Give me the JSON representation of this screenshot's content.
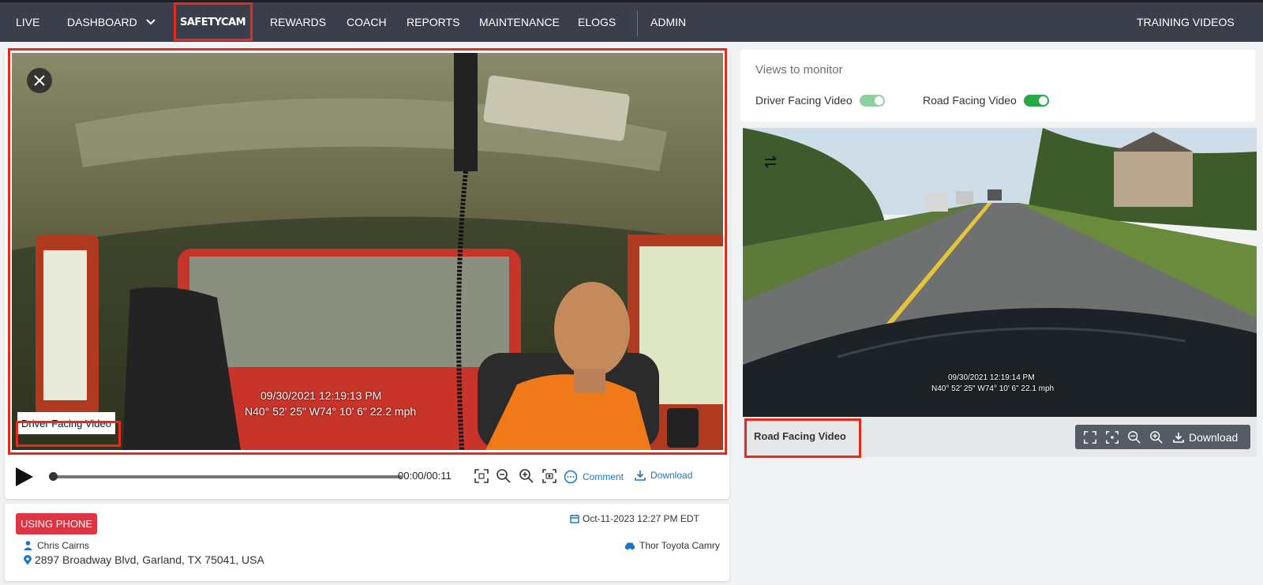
{
  "nav": {
    "live": "LIVE",
    "dashboard": "DASHBOARD",
    "safetycam": "SAFETYCAM",
    "rewards": "REWARDS",
    "coach": "COACH",
    "reports": "REPORTS",
    "maintenance": "MAINTENANCE",
    "elogs": "ELOGS",
    "admin": "ADMIN",
    "training_videos": "TRAINING VIDEOS"
  },
  "driver_video": {
    "label": "Driver Facing Video",
    "osd_datetime": "09/30/2021 12:19:13 PM",
    "osd_location": "N40° 52' 25\" W74° 10' 6\" 22.2 mph",
    "close_icon": "close-icon"
  },
  "player": {
    "time": "00:00/00:11",
    "progress": 0,
    "comment_label": "Comment",
    "download_label": "Download",
    "icons": [
      "play-icon",
      "fullscreen-icon",
      "zoom-out-icon",
      "zoom-in-icon",
      "screenshot-icon",
      "comment-icon",
      "download-icon"
    ]
  },
  "event": {
    "badge": "USING PHONE",
    "badge_color": "#dc3545",
    "datetime": "Oct-11-2023 12:27 PM EDT",
    "driver": "Chris Cairns",
    "address": "2897 Broadway Blvd, Garland, TX 75041, USA",
    "vehicle": "Thor Toyota Camry"
  },
  "views": {
    "title": "Views to monitor",
    "driver_toggle_label": "Driver Facing Video",
    "driver_toggle_on": true,
    "driver_toggle_color": "#8fd19e",
    "road_toggle_label": "Road Facing Video",
    "road_toggle_on": true,
    "road_toggle_color": "#28a745"
  },
  "road_video": {
    "label": "Road Facing Video",
    "osd_datetime": "09/30/2021 12:19:14 PM",
    "osd_location": "N40° 52' 25\" W74° 10' 6\" 22.1 mph",
    "download_label": "Download",
    "swap_icon": "swap-icon"
  },
  "highlight_color": "#e8291c",
  "accent_link_color": "#1a73c8"
}
